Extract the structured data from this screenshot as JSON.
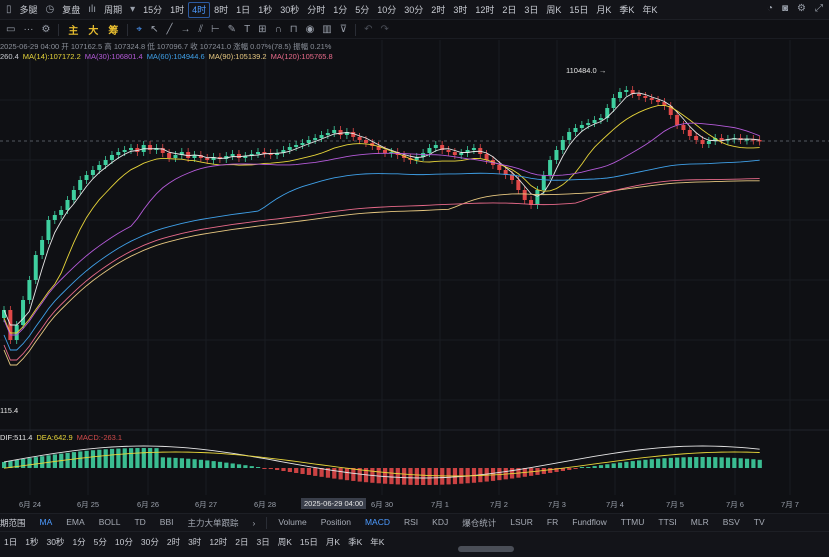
{
  "topbar": {
    "symbol_label": "多腿",
    "replay_label": "复盘",
    "period_label": "周期",
    "intervals": [
      "15分",
      "1时",
      "4时",
      "8时",
      "1日",
      "1秒",
      "30秒",
      "分时",
      "1分",
      "5分",
      "10分",
      "30分",
      "2时",
      "3时",
      "12时",
      "2日",
      "3日",
      "周K",
      "15日",
      "月K",
      "季K",
      "年K"
    ],
    "active_interval": "4时"
  },
  "toolbar2": {
    "indicator_tags": [
      "主",
      "大",
      "筹"
    ]
  },
  "info": {
    "line1": "2025-06-29 04:00  开 107162.5  高 107324.8  低 107096.7  收 107241.0  涨幅 0.07%(78.5)  振幅 0.21%",
    "ma_items": [
      {
        "text": "260.4",
        "color": "#c9ccd3"
      },
      {
        "text": "MA(14):107172.2",
        "color": "#e7d53a"
      },
      {
        "text": "MA(30):106801.4",
        "color": "#b45ad8"
      },
      {
        "text": "MA(60):104944.6",
        "color": "#3fa0e8"
      },
      {
        "text": "MA(90):105139.2",
        "color": "#e6c780"
      },
      {
        "text": "MA(120):105765.8",
        "color": "#e86a8a"
      }
    ]
  },
  "chart": {
    "high_label": "110484.0",
    "low_label": "115.4",
    "macd_items": [
      {
        "text": "DIF:511.4",
        "color": "#e6e6e6"
      },
      {
        "text": "DEA:642.9",
        "color": "#e7d53a"
      },
      {
        "text": "MACD:-263.1",
        "color": "#d14b4b"
      }
    ],
    "colors": {
      "up": "#3fcf9f",
      "down": "#e04848",
      "ma1": "#e6e6e6",
      "ma2": "#e7d53a",
      "ma3": "#b45ad8",
      "ma4": "#3fa0e8",
      "ma5": "#e6c780",
      "ma6": "#e86a8a"
    }
  },
  "xaxis": {
    "labels": [
      "6月 24",
      "6月 25",
      "6月 26",
      "6月 27",
      "6月 28",
      "6月 30",
      "7月 1",
      "7月 2",
      "7月 3",
      "7月 4",
      "7月 5",
      "7月 6",
      "7月 7"
    ],
    "cursor_label": "2025-06-29 04:00"
  },
  "indicator_tabs": {
    "left_label": "期范围",
    "main": [
      "MA",
      "EMA",
      "BOLL",
      "TD",
      "BBI",
      "主力大单跟踪"
    ],
    "sub": [
      "Volume",
      "Position",
      "MACD",
      "RSI",
      "KDJ",
      "爆仓统计",
      "LSUR",
      "FR",
      "Fundflow",
      "TTMU",
      "TTSI",
      "MLR",
      "BSV",
      "TV"
    ],
    "active_main": "MA",
    "active_sub": "MACD"
  },
  "bottom": {
    "intervals": [
      "1日",
      "1秒",
      "30秒",
      "1分",
      "5分",
      "10分",
      "30分",
      "2时",
      "3时",
      "12时",
      "2日",
      "3日",
      "周K",
      "15日",
      "月K",
      "季K",
      "年K"
    ]
  }
}
